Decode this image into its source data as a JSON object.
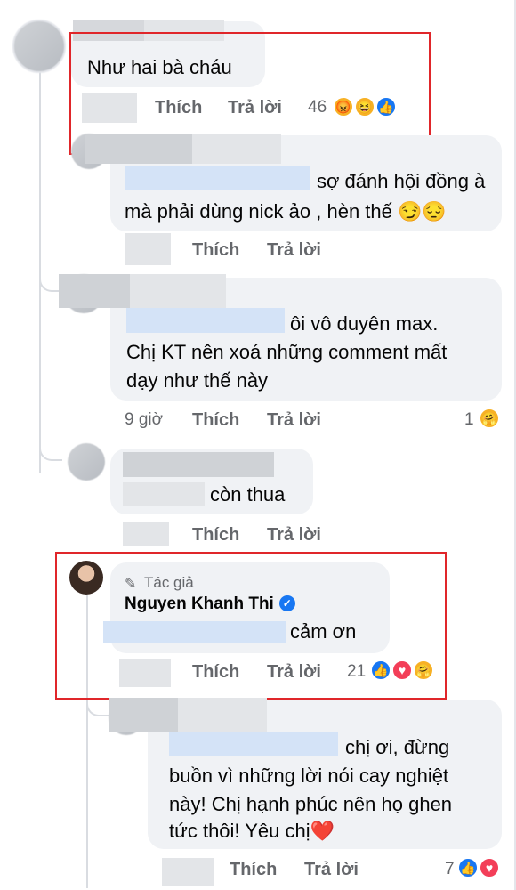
{
  "comments": [
    {
      "text": "Như hai bà cháu",
      "like": "Thích",
      "reply": "Trả lời",
      "count": "46"
    },
    {
      "text_line1": "sợ đánh hội đồng à",
      "text_line2": "mà phải dùng nick ảo , hèn thế 😏😔",
      "like": "Thích",
      "reply": "Trả lời"
    },
    {
      "line1": "ôi vô duyên max.",
      "line2": "Chị KT nên xoá những comment mất",
      "line3": "dạy như thế này",
      "time": "9 giờ",
      "like": "Thích",
      "reply": "Trả lời",
      "count": "1"
    },
    {
      "text": "còn thua",
      "like": "Thích",
      "reply": "Trả lời"
    },
    {
      "author_tag": "Tác giả",
      "author_name": "Nguyen Khanh Thi",
      "text": "cảm ơn",
      "like": "Thích",
      "reply": "Trả lời",
      "count": "21"
    },
    {
      "line1": "chị ơi, đừng",
      "line2": "buồn vì những lời nói cay nghiệt",
      "line3": "này! Chị hạnh phúc nên họ ghen",
      "line4": "tức thôi! Yêu chị❤️",
      "like": "Thích",
      "reply": "Trả lời",
      "count": "7"
    }
  ],
  "icons": [
    "angry-reaction-icon",
    "haha-reaction-icon",
    "like-reaction-icon",
    "love-reaction-icon",
    "care-reaction-icon",
    "pencil-icon",
    "verified-badge-icon"
  ],
  "colors": {
    "highlight_box": "#e0262a",
    "bubble": "#f0f2f5",
    "meta": "#65676b",
    "like_blue": "#1877f2",
    "love_red": "#f33e58"
  }
}
